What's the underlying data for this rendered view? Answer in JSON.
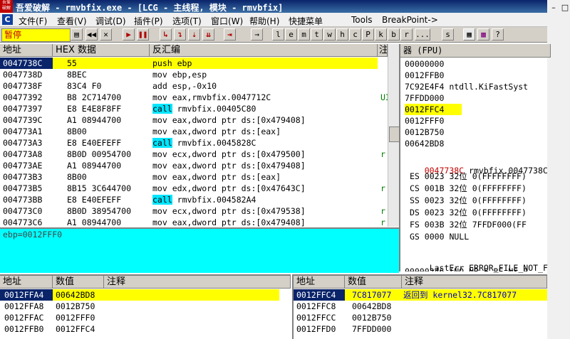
{
  "window": {
    "logo_text": "吾爱破解",
    "title": "吾爱破解 - rmvbfix.exe - [LCG - 主线程, 模块 - rmvbfix]"
  },
  "menu": {
    "app_icon": "C",
    "items": [
      "文件(F)",
      "查看(V)",
      "调试(D)",
      "插件(P)",
      "选项(T)",
      "窗口(W)",
      "帮助(H)",
      "快捷菜单",
      "Tools",
      "BreakPoint->"
    ]
  },
  "toolbar": {
    "status": "暂停",
    "letter_buttons": [
      "l",
      "e",
      "m",
      "t",
      "w",
      "h",
      "c",
      "P",
      "k",
      "b",
      "r",
      "...",
      "s"
    ]
  },
  "cpu": {
    "headers": {
      "address": "地址",
      "hex": "HEX 数据",
      "disasm": "反汇编",
      "comment": "注"
    },
    "rows": [
      {
        "addr": "0047738C",
        "hex": "55",
        "asm": "push ebp",
        "cmt": ""
      },
      {
        "addr": "0047738D",
        "hex": "8BEC",
        "asm": "mov ebp,esp",
        "cmt": ""
      },
      {
        "addr": "0047738F",
        "hex": "83C4 F0",
        "asm": "add esp,-0x10",
        "cmt": ""
      },
      {
        "addr": "00477392",
        "hex": "B8 2C714700",
        "asm": "mov eax,rmvbfix.0047712C",
        "cmt": "UI"
      },
      {
        "addr": "00477397",
        "hex": "E8 E4E8F8FF",
        "asm_call": "call",
        "asm": "rmvbfix.00405C80",
        "cmt": ""
      },
      {
        "addr": "0047739C",
        "hex": "A1 08944700",
        "asm": "mov eax,dword ptr ds:[0x479408]",
        "cmt": ""
      },
      {
        "addr": "004773A1",
        "hex": "8B00",
        "asm": "mov eax,dword ptr ds:[eax]",
        "cmt": ""
      },
      {
        "addr": "004773A3",
        "hex": "E8 E40EFEFF",
        "asm_call": "call",
        "asm": "rmvbfix.0045828C",
        "cmt": ""
      },
      {
        "addr": "004773A8",
        "hex": "8B0D 00954700",
        "asm": "mov ecx,dword ptr ds:[0x479500]",
        "cmt": "r"
      },
      {
        "addr": "004773AE",
        "hex": "A1 08944700",
        "asm": "mov eax,dword ptr ds:[0x479408]",
        "cmt": ""
      },
      {
        "addr": "004773B3",
        "hex": "8B00",
        "asm": "mov eax,dword ptr ds:[eax]",
        "cmt": ""
      },
      {
        "addr": "004773B5",
        "hex": "8B15 3C644700",
        "asm": "mov edx,dword ptr ds:[0x47643C]",
        "cmt": "r"
      },
      {
        "addr": "004773BB",
        "hex": "E8 E40EFEFF",
        "asm_call": "call",
        "asm": "rmvbfix.004582A4",
        "cmt": ""
      },
      {
        "addr": "004773C0",
        "hex": "8B0D 38954700",
        "asm": "mov ecx,dword ptr ds:[0x479538]",
        "cmt": "r"
      },
      {
        "addr": "004773C6",
        "hex": "A1 08944700",
        "asm": "mov eax,dword ptr ds:[0x479408]",
        "cmt": "r"
      }
    ],
    "info": "ebp=0012FFF0"
  },
  "registers": {
    "header": "器 (FPU)",
    "top": [
      {
        "val": "00000000",
        "note": ""
      },
      {
        "val": "0012FFB0",
        "note": ""
      },
      {
        "val": "7C92E4F4",
        "note": "ntdll.KiFastSyst"
      },
      {
        "val": "7FFDD000",
        "note": ""
      },
      {
        "val": "0012FFC4",
        "note": ""
      },
      {
        "val": "0012FFF0",
        "note": ""
      },
      {
        "val": "0012B750",
        "note": ""
      },
      {
        "val": "00642BD8",
        "note": ""
      }
    ],
    "eip_val": "0047738C",
    "eip_note": "rmvbfix.0047738C",
    "segments": [
      {
        "name": "ES",
        "sel": "0023",
        "bits": "32位",
        "base": "0(FFFFFFFF)"
      },
      {
        "name": "CS",
        "sel": "001B",
        "bits": "32位",
        "base": "0(FFFFFFFF)"
      },
      {
        "name": "SS",
        "sel": "0023",
        "bits": "32位",
        "base": "0(FFFFFFFF)"
      },
      {
        "name": "DS",
        "sel": "0023",
        "bits": "32位",
        "base": "0(FFFFFFFF)"
      },
      {
        "name": "FS",
        "sel": "003B",
        "bits": "32位",
        "base": "7FFDF000(FF"
      },
      {
        "name": "GS",
        "sel": "0000",
        "bits": "NULL",
        "base": ""
      }
    ],
    "lasterr_label": "LastErr",
    "lasterr_value": "ERROR_FILE_NOT_F",
    "cut_line": "00000246 (NO,NB,E,BE,NS,P"
  },
  "dump": {
    "headers": {
      "address": "地址",
      "value": "数值",
      "comment": "注释"
    },
    "rows": [
      {
        "addr": "0012FFA4",
        "val": "00642BD8"
      },
      {
        "addr": "0012FFA8",
        "val": "0012B750"
      },
      {
        "addr": "0012FFAC",
        "val": "0012FFF0"
      },
      {
        "addr": "0012FFB0",
        "val": "0012FFC4"
      }
    ]
  },
  "stack": {
    "headers": {
      "address": "地址",
      "value": "数值",
      "comment": "注释"
    },
    "rows": [
      {
        "addr": "0012FFC4",
        "val": "7C817077",
        "cmt": "返回到 kernel32.7C817077"
      },
      {
        "addr": "0012FFC8",
        "val": "00642BD8",
        "cmt": ""
      },
      {
        "addr": "0012FFCC",
        "val": "0012B750",
        "cmt": ""
      },
      {
        "addr": "0012FFD0",
        "val": "7FFDD000",
        "cmt": ""
      }
    ]
  },
  "colors": {
    "selection": "#0a246a",
    "highlight": "#ffff00",
    "call": "#00e5ff",
    "info_bg": "#00ffff"
  }
}
